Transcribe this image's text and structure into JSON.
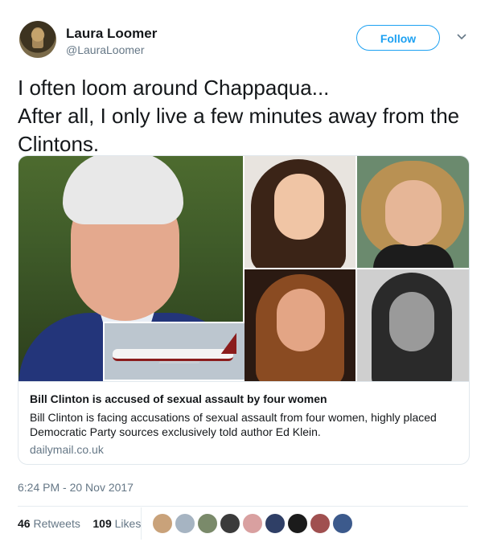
{
  "author": {
    "name": "Laura Loomer",
    "handle": "@LauraLoomer"
  },
  "follow_label": "Follow",
  "tweet_text": "I often loom around Chappaqua...\nAfter all, I only live a few minutes away from the Clintons.",
  "card": {
    "title": "Bill Clinton is accused of sexual assault by four women",
    "description": "Bill Clinton is facing accusations of sexual assault from four women, highly placed Democratic Party sources exclusively told author Ed Klein.",
    "domain": "dailymail.co.uk"
  },
  "timestamp": "6:24 PM - 20 Nov 2017",
  "stats": {
    "retweets_count": "46",
    "retweets_label": "Retweets",
    "likes_count": "109",
    "likes_label": "Likes"
  },
  "liker_colors": [
    "#c9a27a",
    "#a6b4c2",
    "#7a8a6a",
    "#3b3b3b",
    "#d9a0a0",
    "#2f3f66",
    "#1b1b1b",
    "#a05050",
    "#3c5a8c"
  ],
  "colors": {
    "accent": "#1da1f2",
    "muted": "#657786",
    "text": "#14171a"
  }
}
